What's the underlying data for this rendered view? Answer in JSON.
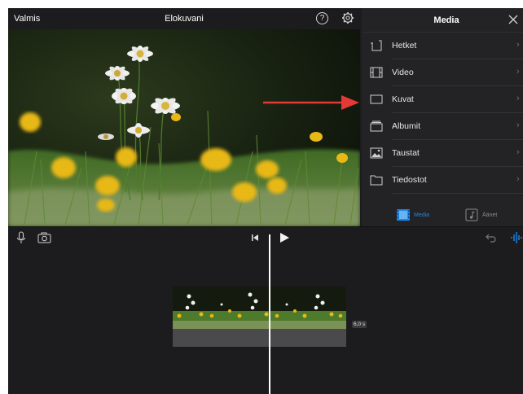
{
  "topbar": {
    "done_label": "Valmis",
    "project_title": "Elokuvani",
    "help_glyph": "?"
  },
  "media_panel": {
    "title": "Media",
    "items": [
      {
        "label": "Hetket",
        "icon": "moments-icon"
      },
      {
        "label": "Video",
        "icon": "film-icon"
      },
      {
        "label": "Kuvat",
        "icon": "photo-frame-icon"
      },
      {
        "label": "Albumit",
        "icon": "albums-icon"
      },
      {
        "label": "Taustat",
        "icon": "backgrounds-icon"
      },
      {
        "label": "Tiedostot",
        "icon": "folder-icon"
      }
    ],
    "chevron": "›",
    "tabs": [
      {
        "label": "Media",
        "icon": "media-tab-icon",
        "active": true
      },
      {
        "label": "Äänet",
        "icon": "audio-tab-icon",
        "active": false
      }
    ]
  },
  "timeline": {
    "clip_duration": "6,0 s"
  },
  "colors": {
    "accent_blue": "#1e88e5",
    "annotation_red": "#e53935",
    "background": "#1c1c1e",
    "panel": "#232325"
  }
}
